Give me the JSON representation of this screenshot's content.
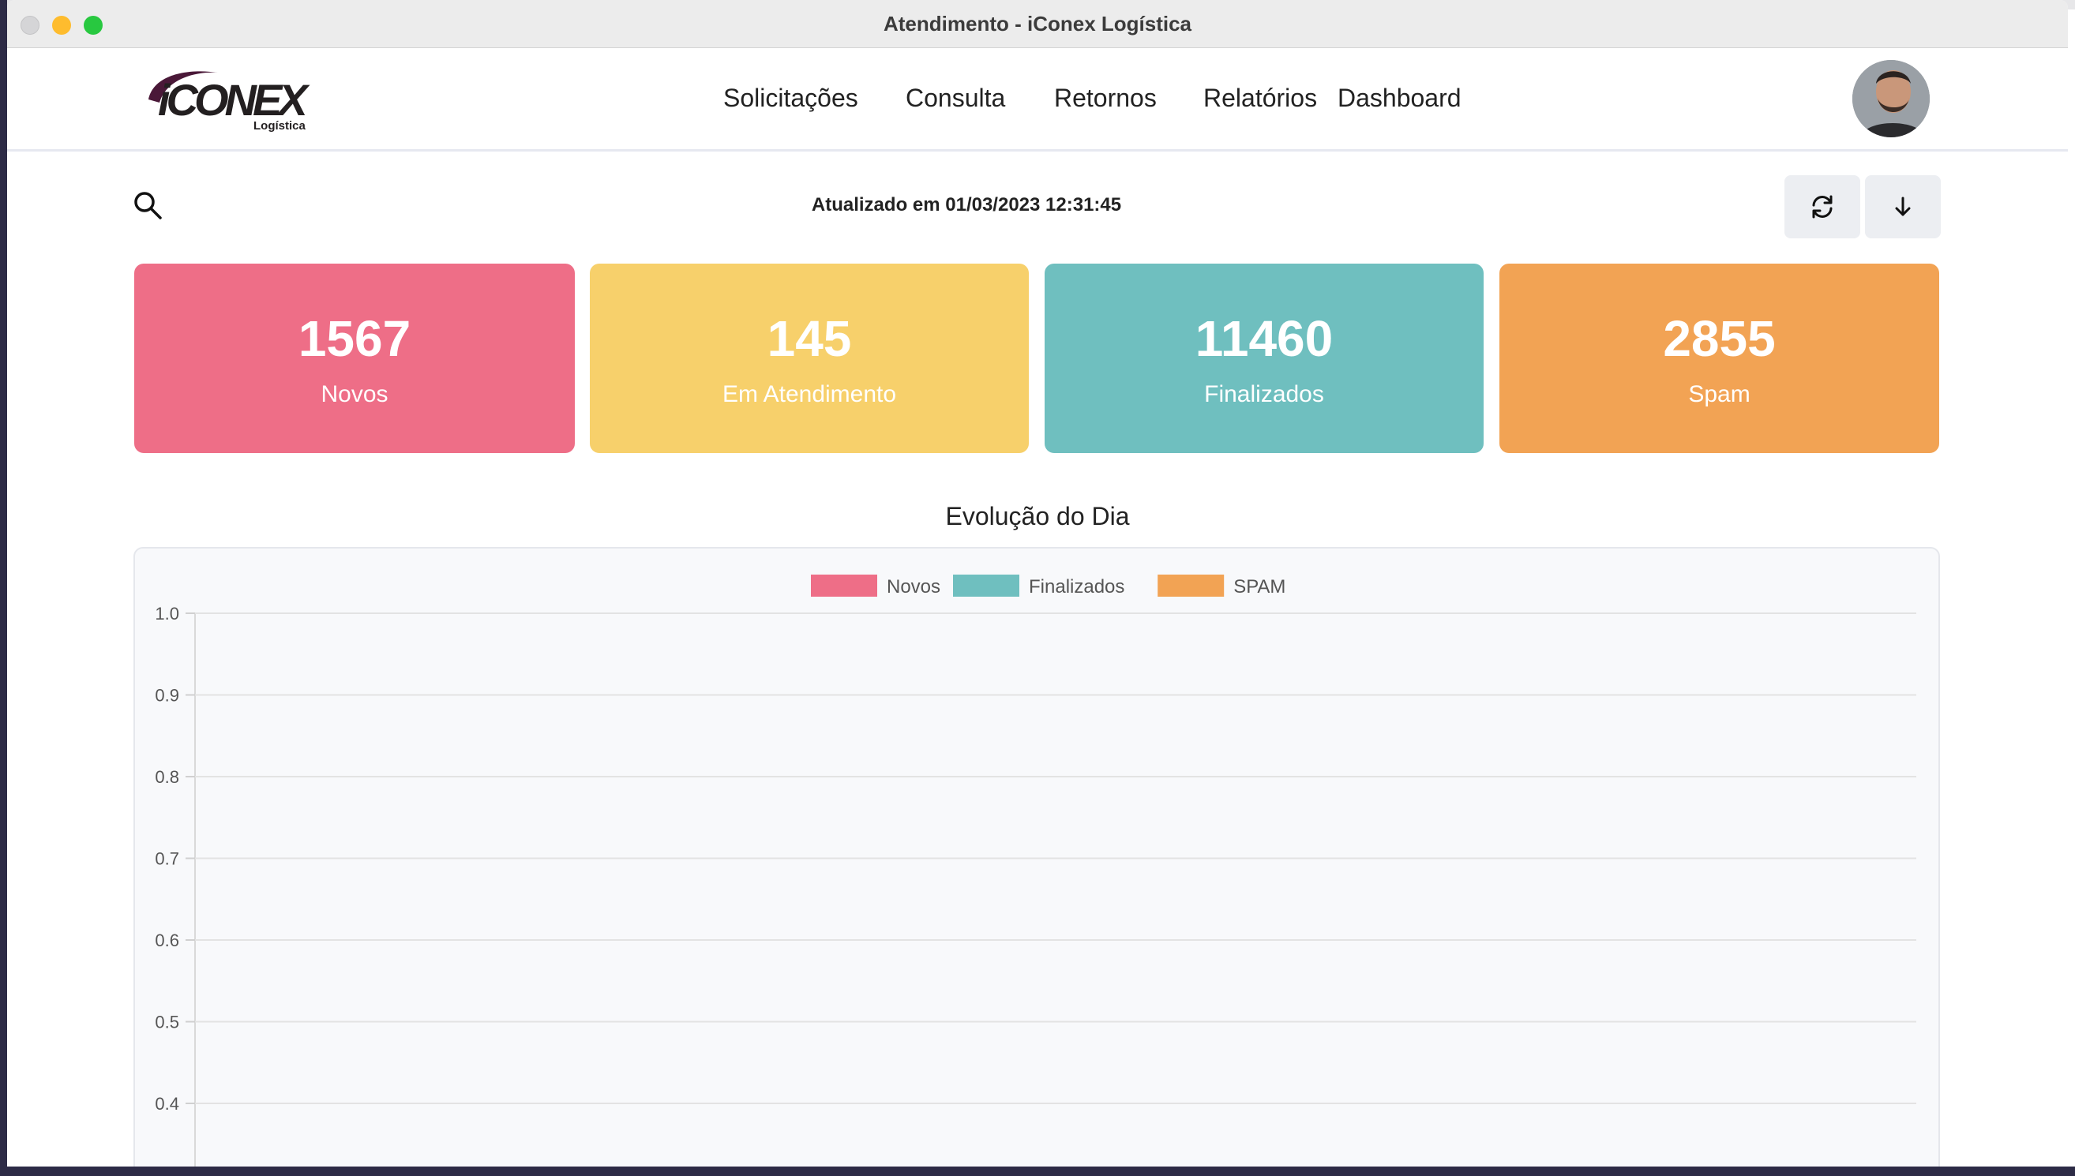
{
  "window": {
    "title": "Atendimento - iConex Logística"
  },
  "brand": {
    "logo_text": "iCONEX",
    "logo_sub": "Logística"
  },
  "nav": [
    {
      "label": "Solicitações"
    },
    {
      "label": "Consulta"
    },
    {
      "label": "Retornos"
    },
    {
      "label": "Relatórios"
    },
    {
      "label": "Dashboard"
    }
  ],
  "toolbar": {
    "updated_text": "Atualizado em 01/03/2023 12:31:45",
    "refresh_icon": "refresh-icon",
    "download_icon": "arrow-down-icon",
    "search_icon": "search-icon"
  },
  "cards": [
    {
      "value": "1567",
      "label": "Novos",
      "color": "#ee6e87"
    },
    {
      "value": "145",
      "label": "Em Atendimento",
      "color": "#f7d06b"
    },
    {
      "value": "11460",
      "label": "Finalizados",
      "color": "#6fbfbf"
    },
    {
      "value": "2855",
      "label": "Spam",
      "color": "#f2a354"
    }
  ],
  "chart_section": {
    "title": "Evolução do Dia"
  },
  "chart_data": {
    "type": "line",
    "series": [
      {
        "name": "Novos",
        "color": "#ee6e87",
        "values": []
      },
      {
        "name": "Finalizados",
        "color": "#6fbfbf",
        "values": []
      },
      {
        "name": "SPAM",
        "color": "#f2a354",
        "values": []
      }
    ],
    "legend": "top-center",
    "grid": true,
    "ylim": [
      0,
      1.0
    ],
    "yticks": [
      "1.0",
      "0.9",
      "0.8",
      "0.7",
      "0.6",
      "0.5",
      "0.4"
    ]
  }
}
